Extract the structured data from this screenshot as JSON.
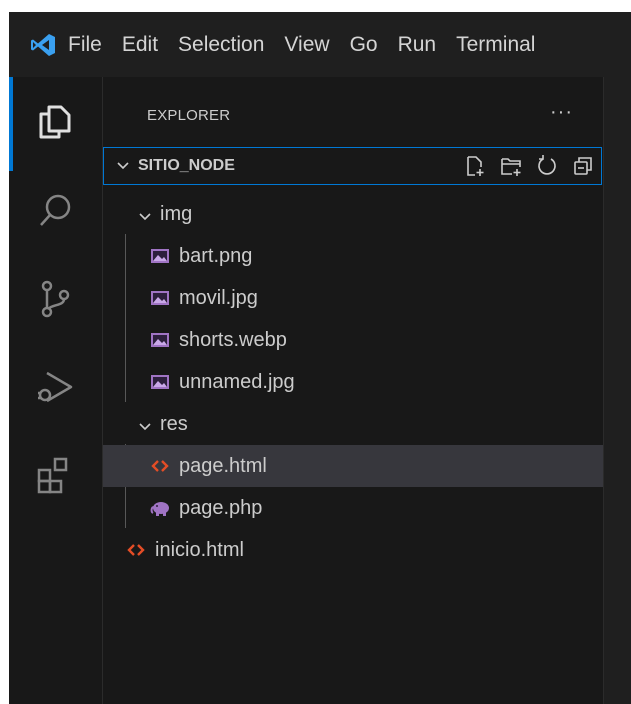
{
  "menu": [
    "File",
    "Edit",
    "Selection",
    "View",
    "Go",
    "Run",
    "Terminal"
  ],
  "explorer": {
    "title": "EXPLORER",
    "more": "···",
    "root": "SITIO_NODE",
    "items": [
      {
        "label": "img",
        "type": "folder"
      },
      {
        "label": "bart.png",
        "type": "image"
      },
      {
        "label": "movil.jpg",
        "type": "image"
      },
      {
        "label": "shorts.webp",
        "type": "image"
      },
      {
        "label": "unnamed.jpg",
        "type": "image"
      },
      {
        "label": "res",
        "type": "folder"
      },
      {
        "label": "page.html",
        "type": "html"
      },
      {
        "label": "page.php",
        "type": "php"
      },
      {
        "label": "inicio.html",
        "type": "html"
      }
    ]
  },
  "colors": {
    "accent": "#0078d4",
    "html_icon": "#e44d26",
    "image_icon": "#a074c4",
    "php_icon": "#a074c4"
  },
  "icons": {
    "activity": [
      "explorer-icon",
      "search-icon",
      "source-control-icon",
      "run-debug-icon",
      "extensions-icon"
    ],
    "root_actions": [
      "new-file-icon",
      "new-folder-icon",
      "refresh-icon",
      "collapse-all-icon"
    ]
  }
}
